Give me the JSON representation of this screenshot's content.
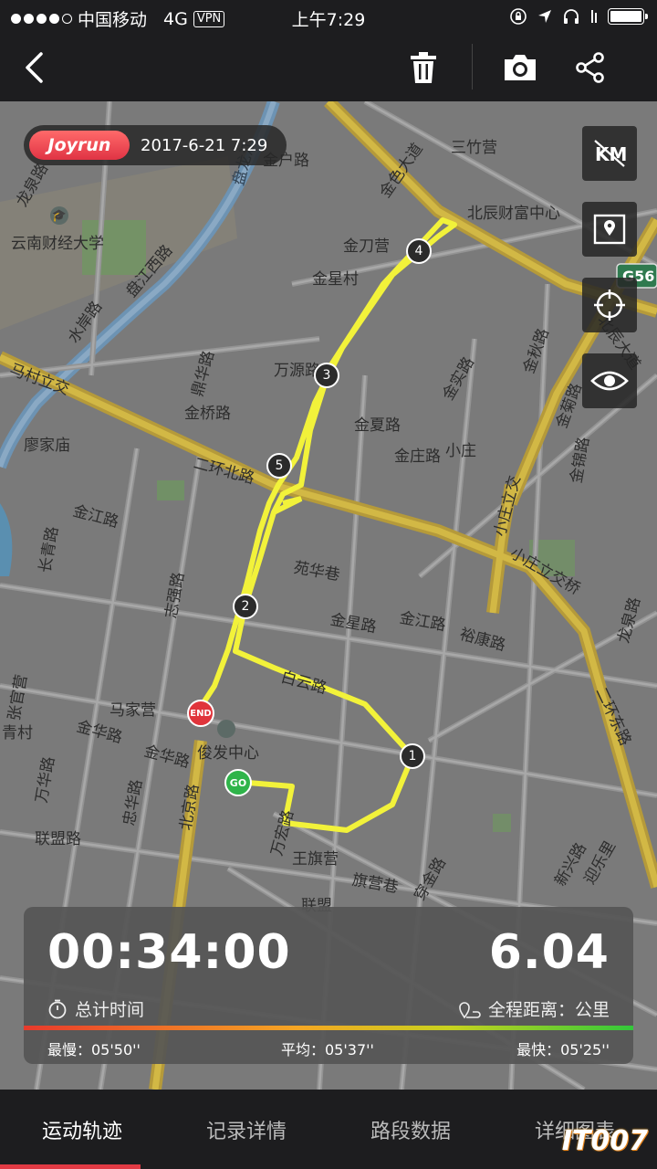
{
  "status_bar": {
    "carrier": "中国移动",
    "network": "4G",
    "vpn": "VPN",
    "time": "上午7:29"
  },
  "toolbar": {
    "back_icon": "chevron-left-icon",
    "delete_icon": "trash-icon",
    "camera_icon": "camera-icon",
    "share_icon": "share-icon"
  },
  "badge": {
    "brand": "Joyrun",
    "date": "2017-6-21 7:29"
  },
  "map_controls": {
    "km": "KM",
    "icons": [
      "km-toggle-icon",
      "map-pin-icon",
      "locate-icon",
      "eye-icon"
    ]
  },
  "map": {
    "labels": [
      "龙泉路",
      "云南财经大学",
      "盘江西路",
      "金户路",
      "盘龙江",
      "金色大道",
      "三竹营",
      "北辰财富中心",
      "金刀营",
      "金星村",
      "G56",
      "北辰大道",
      "水岸路",
      "马村立交",
      "万源路",
      "金实路",
      "金秋路",
      "金菊路",
      "金桥路",
      "鼎华路",
      "金夏路",
      "金庄路",
      "小庄",
      "二环北路",
      "小庄立交",
      "金锦路",
      "小庄立交桥",
      "廖家庙",
      "金江路",
      "长青路",
      "苑华巷",
      "志强路",
      "金星路",
      "金江路",
      "裕康路",
      "龙泉路",
      "白云路",
      "马家营",
      "俊发中心",
      "二环东路",
      "张官营",
      "金华路",
      "金华路",
      "青村",
      "万华路",
      "忠华路",
      "北京路",
      "万宏路",
      "联盟路",
      "王旗营",
      "旗营巷",
      "穿金路",
      "新兴路",
      "迎乐里",
      "联盟"
    ],
    "markers": {
      "go": "GO",
      "end": "END",
      "km": [
        "1",
        "2",
        "3",
        "4",
        "5"
      ]
    }
  },
  "stats": {
    "duration": "00:34:00",
    "duration_label": "总计时间",
    "distance": "6.04",
    "distance_label": "全程距离：公里",
    "slowest": "最慢：05'50''",
    "average": "平均：05'37''",
    "fastest": "最快：05'25''"
  },
  "tabs": [
    "运动轨迹",
    "记录详情",
    "路段数据",
    "详细图表"
  ],
  "watermark": "IT007",
  "colors": {
    "track": "#f2f23a",
    "accent": "#e23a44",
    "go": "#2fb44a",
    "end": "#e0343b"
  }
}
